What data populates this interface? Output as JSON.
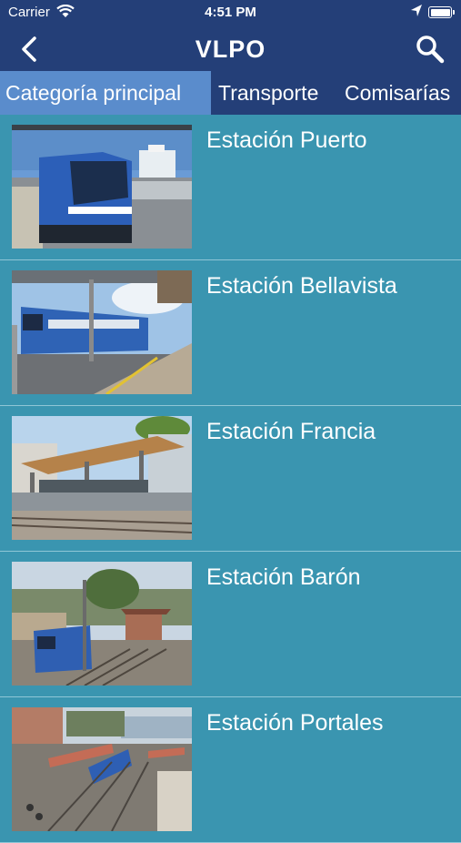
{
  "status": {
    "carrier": "Carrier",
    "time": "4:51 PM"
  },
  "navbar": {
    "title": "VLPO",
    "back_icon": "chevron-left-icon",
    "search_icon": "search-icon"
  },
  "tabs": [
    {
      "label": "Categoría principal",
      "active": true
    },
    {
      "label": "Transporte",
      "active": false
    },
    {
      "label": "Comisarías",
      "active": false
    }
  ],
  "stations": [
    {
      "name": "Estación Puerto"
    },
    {
      "name": "Estación Bellavista"
    },
    {
      "name": "Estación Francia"
    },
    {
      "name": "Estación Barón"
    },
    {
      "name": "Estación Portales"
    }
  ],
  "colors": {
    "bar": "#243f78",
    "active_tab": "#5a8ccc",
    "list_bg": "#3a95b0",
    "divider": "#8fc6d6"
  }
}
